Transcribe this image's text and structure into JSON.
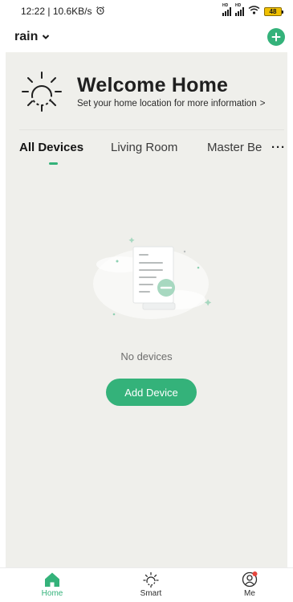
{
  "status_bar": {
    "time_speed": "12:22 | 10.6KB/s",
    "battery": "48"
  },
  "header": {
    "home_name": "rain"
  },
  "welcome": {
    "title": "Welcome Home",
    "subtitle": "Set your home location for more information",
    "arrow": ">"
  },
  "tabs": {
    "items": [
      {
        "label": "All Devices"
      },
      {
        "label": "Living Room"
      },
      {
        "label": "Master Be"
      }
    ],
    "more": "···"
  },
  "empty_state": {
    "text": "No devices",
    "button": "Add Device"
  },
  "bottom_nav": {
    "items": [
      {
        "label": "Home"
      },
      {
        "label": "Smart"
      },
      {
        "label": "Me"
      }
    ]
  },
  "colors": {
    "accent": "#34b27a",
    "background": "#efefeb",
    "badge": "#e5453d"
  }
}
